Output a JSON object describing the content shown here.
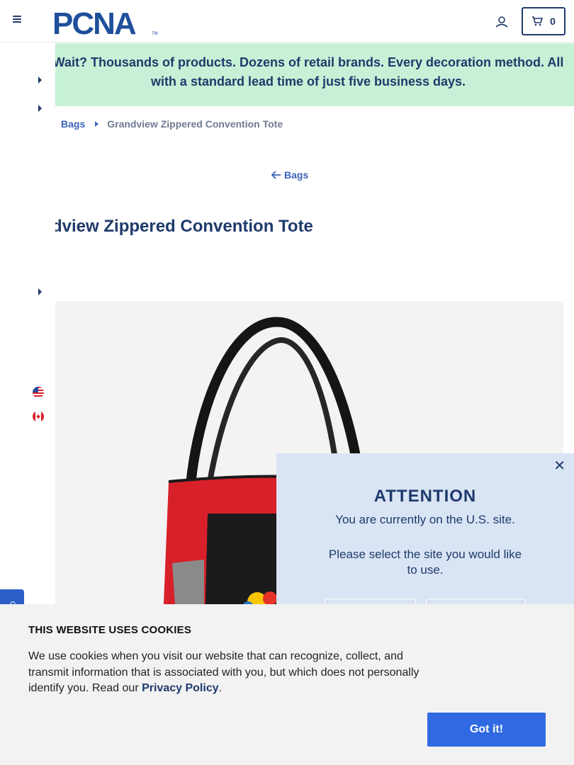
{
  "header": {
    "logo_text": "PCNA",
    "logo_tm": "TM",
    "cart_count": "0"
  },
  "banner": {
    "text": "Wait? Thousands of products. Dozens of retail brands. Every decoration method. All with a standard lead time of just five business days."
  },
  "breadcrumb": {
    "parent": "Bags",
    "current": "Grandview Zippered Convention Tote"
  },
  "back_link": "Bags",
  "product": {
    "title": "Grandview Zippered Convention Tote",
    "title_visible": "dview Zippered Convention Tote"
  },
  "modal": {
    "title": "ATTENTION",
    "line1": "You are currently on the U.S. site.",
    "line2": "Please select the site you would like to use."
  },
  "feedback_label": "G",
  "cookie": {
    "title": "THIS WEBSITE USES COOKIES",
    "text_before": "We use cookies when you visit our website that can recognize, collect, and transmit information that is associated with you, but which does not personally identify you. Read our ",
    "link": "Privacy Policy",
    "text_after": ".",
    "button": "Got it!"
  },
  "colors": {
    "brand_navy": "#1f3a6b",
    "link_blue": "#3c63b8",
    "banner_green": "#c6f1d6",
    "modal_bg": "#d9e4f4",
    "cookie_button": "#2f6ae3",
    "tote_red": "#d8202b"
  }
}
